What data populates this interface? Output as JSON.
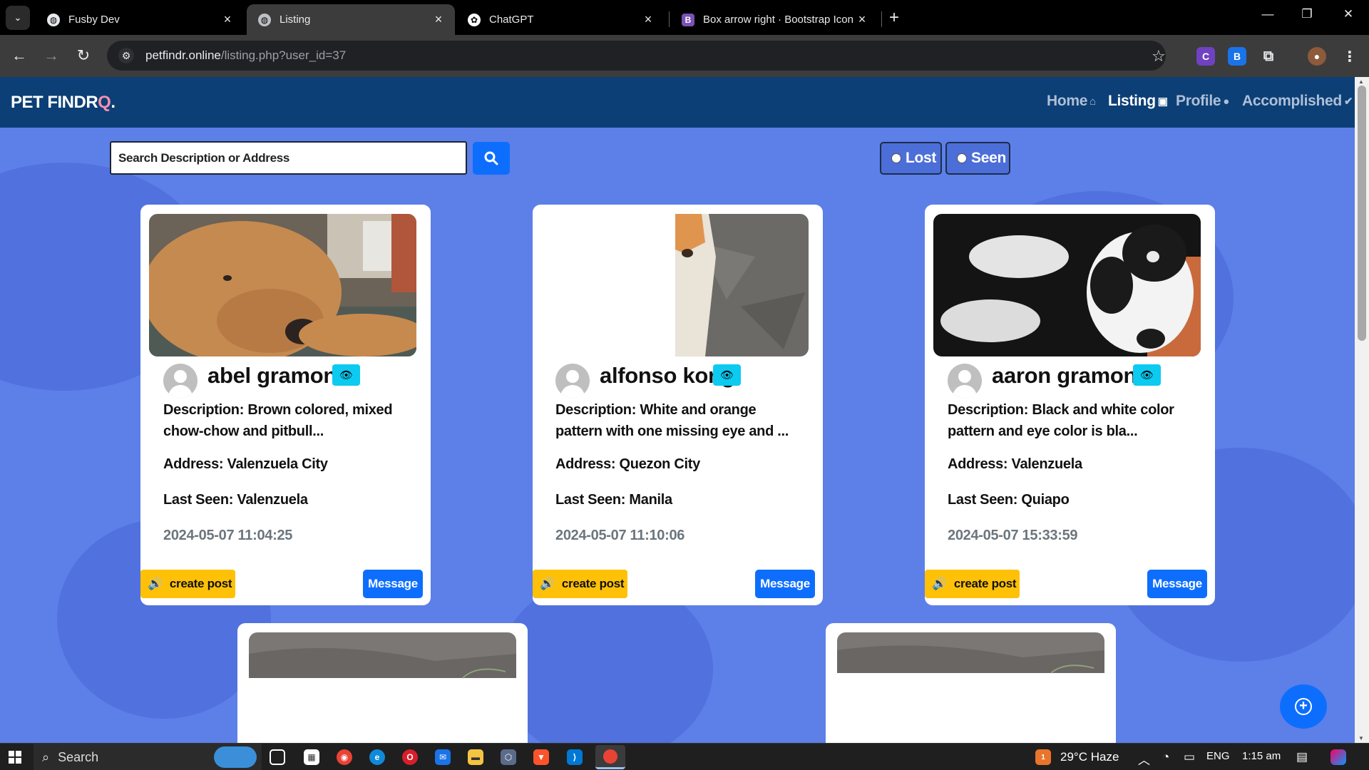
{
  "browser": {
    "tabs": [
      {
        "title": "Fusby Dev",
        "icon": "globe-icon"
      },
      {
        "title": "Listing",
        "icon": "globe-icon",
        "active": true
      },
      {
        "title": "ChatGPT",
        "icon": "chatgpt-icon"
      },
      {
        "title": "Box arrow right · Bootstrap Icon",
        "icon": "bootstrap-icon"
      }
    ],
    "url_host": "petfindr.online",
    "url_path": "/listing.php?user_id=37"
  },
  "site": {
    "brand": "PET FINDR",
    "brand_suffix": ".",
    "nav": [
      {
        "label": "Home",
        "icon": "house-icon"
      },
      {
        "label": "Listing",
        "icon": "listing-icon",
        "active": true
      },
      {
        "label": "Profile",
        "icon": "person-icon"
      },
      {
        "label": "Accomplished",
        "icon": "check-circle-icon"
      }
    ]
  },
  "search": {
    "placeholder": "Search Description or Address"
  },
  "filters": [
    {
      "label": "Lost"
    },
    {
      "label": "Seen"
    }
  ],
  "cards": [
    {
      "name": "abel gramonte",
      "description": "Description: Brown colored, mixed chow-chow and pitbull...",
      "address": "Address: Valenzuela City",
      "last_seen": "Last Seen: Valenzuela",
      "date": "2024-05-07 11:04:25",
      "post_label": "create post",
      "message_label": "Message"
    },
    {
      "name": "alfonso kong",
      "description": "Description: White and orange pattern with one missing eye and ...",
      "address": "Address: Quezon City",
      "last_seen": "Last Seen: Manila",
      "date": "2024-05-07 11:10:06",
      "post_label": "create post",
      "message_label": "Message"
    },
    {
      "name": "aaron gramonte",
      "description": "Description: Black and white color pattern and eye color is bla...",
      "address": "Address: Valenzuela",
      "last_seen": "Last Seen: Quiapo",
      "date": "2024-05-07 15:33:59",
      "post_label": "create post",
      "message_label": "Message"
    }
  ],
  "taskbar": {
    "search_label": "Search",
    "weather": "29°C Haze",
    "weather_badge": "1",
    "language": "ENG",
    "time": "1:15 am"
  },
  "colors": {
    "navbar": "#0c3f75",
    "page_bg": "#5d7fe8",
    "primary": "#0d6efd",
    "warning": "#ffc107",
    "info": "#0dcaf0"
  }
}
